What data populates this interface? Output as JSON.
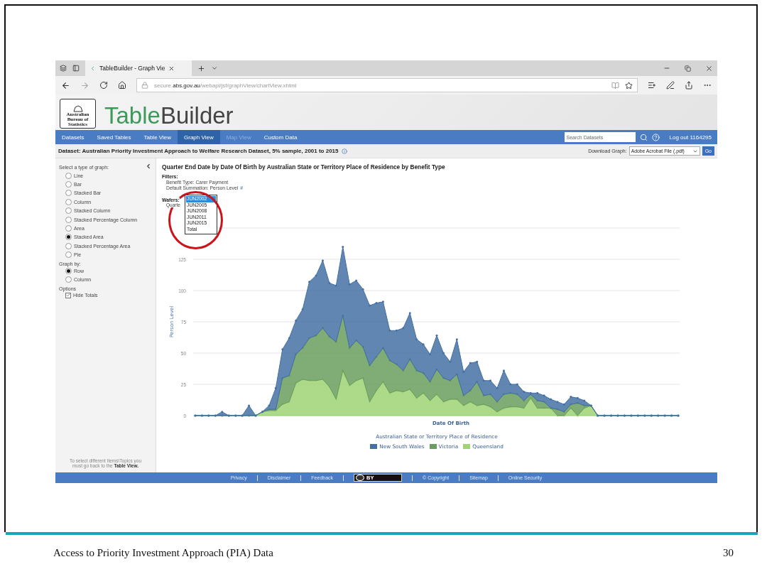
{
  "browser": {
    "tab_title": "TableBuilder - Graph Vie",
    "url": "secure.**abs.gov.au**/webapi/jsf/graphView/chartView.xhtml"
  },
  "header": {
    "logo_text": "Australian Bureau of Statistics",
    "app_title": "**Table**Builder"
  },
  "nav": {
    "items": [
      {
        "label": "Datasets",
        "selected": false,
        "disabled": false
      },
      {
        "label": "Saved Tables",
        "selected": false,
        "disabled": false
      },
      {
        "label": "Table View",
        "selected": false,
        "disabled": false
      },
      {
        "label": "Graph View",
        "selected": true,
        "disabled": false
      },
      {
        "label": "Map View",
        "selected": false,
        "disabled": true
      },
      {
        "label": "Custom Data",
        "selected": false,
        "disabled": false
      }
    ],
    "search": {
      "placeholder": "Search Datasets"
    },
    "logout": "Log out 1164295"
  },
  "dataset_bar": {
    "title": "Dataset: Australian Priority Investment Approach to Welfare Research Dataset, 5% sample, 2001 to 2015",
    "download_label": "Download Graph:",
    "download_format": "Adobe Acrobat File (.pdf)",
    "go": "Go"
  },
  "sidebar": {
    "graph_type_heading": "Select a type of graph:",
    "graph_types": [
      {
        "label": "Line",
        "selected": false
      },
      {
        "label": "Bar",
        "selected": false
      },
      {
        "label": "Stacked Bar",
        "selected": false
      },
      {
        "label": "Column",
        "selected": false
      },
      {
        "label": "Stacked Column",
        "selected": false
      },
      {
        "label": "Stacked Percentage Column",
        "selected": false
      },
      {
        "label": "Area",
        "selected": false
      },
      {
        "label": "Stacked Area",
        "selected": true
      },
      {
        "label": "Stacked Percentage Area",
        "selected": false
      },
      {
        "label": "Pie",
        "selected": false
      }
    ],
    "graph_by_heading": "Graph by:",
    "graph_by": [
      {
        "label": "Row",
        "selected": true
      },
      {
        "label": "Column",
        "selected": false
      }
    ],
    "options_heading": "Options",
    "options": [
      {
        "label": "Hide Totals",
        "checked": true
      }
    ],
    "note": "To select different Items\\Topics you must go back to the **Table View.**"
  },
  "chart_panel": {
    "title": "Quarter End Date by Date Of Birth by Australian State or Territory Place of Residence by Benefit Type",
    "filters_heading": "Filters:",
    "filters": [
      "Benefit Type: Carer Payment",
      "Default Summation: Person Level"
    ],
    "filter_link": "#",
    "wafers_label": "Wafers:",
    "wafer_row_label": "Quarte",
    "wafer_options": [
      {
        "label": "JUN2002",
        "selected": true
      },
      {
        "label": "JUN2005",
        "selected": false
      },
      {
        "label": "JUN2008",
        "selected": false
      },
      {
        "label": "JUN2011",
        "selected": false
      },
      {
        "label": "JUN2015",
        "selected": false
      },
      {
        "label": "Total",
        "selected": false
      }
    ],
    "legend_title": "Australian State or Territory Place of Residence",
    "chart_data": {
      "type": "area",
      "stacked": true,
      "grid": true,
      "xlabel": "Date Of Birth",
      "ylabel": "Person Level",
      "ylim": [
        0,
        150
      ],
      "yticks": [
        0,
        25,
        50,
        75,
        100,
        125
      ],
      "series": [
        {
          "name": "New South Wales",
          "color": "#4471a3",
          "values": [
            0,
            0,
            0,
            0,
            3,
            0,
            0,
            0,
            8,
            0,
            0,
            3,
            17,
            23,
            30,
            27,
            31,
            45,
            48,
            54,
            43,
            45,
            55,
            51,
            48,
            46,
            48,
            43,
            37,
            24,
            27,
            34,
            37,
            25,
            23,
            22,
            27,
            20,
            15,
            28,
            19,
            22,
            16,
            12,
            11,
            11,
            19,
            7,
            8,
            7,
            1,
            6,
            5,
            7,
            6,
            6,
            6,
            4,
            4,
            0,
            0,
            0,
            0,
            0,
            0,
            0,
            0,
            0,
            0,
            0,
            0,
            0,
            0
          ]
        },
        {
          "name": "Victoria",
          "color": "#6a9e5e",
          "values": [
            0,
            0,
            0,
            0,
            0,
            0,
            0,
            0,
            0,
            0,
            0,
            1,
            1,
            21,
            21,
            23,
            25,
            34,
            36,
            41,
            40,
            46,
            44,
            30,
            32,
            25,
            29,
            27,
            27,
            26,
            21,
            17,
            24,
            22,
            16,
            15,
            20,
            19,
            15,
            20,
            8,
            9,
            19,
            7,
            10,
            8,
            11,
            11,
            10,
            6,
            3,
            6,
            5,
            0,
            5,
            3,
            3,
            10,
            2,
            0,
            0,
            0,
            0,
            0,
            0,
            0,
            0,
            0,
            0,
            0,
            0,
            0,
            0
          ]
        },
        {
          "name": "Queensland",
          "color": "#9fd373",
          "values": [
            0,
            0,
            0,
            0,
            0,
            0,
            0,
            0,
            0,
            0,
            3,
            4,
            4,
            9,
            11,
            26,
            29,
            28,
            28,
            29,
            23,
            13,
            36,
            24,
            28,
            30,
            11,
            20,
            27,
            18,
            20,
            19,
            21,
            14,
            18,
            12,
            17,
            11,
            13,
            13,
            8,
            11,
            8,
            9,
            7,
            3,
            6,
            7,
            7,
            6,
            14,
            6,
            6,
            6,
            0,
            0,
            6,
            0,
            6,
            8,
            0,
            0,
            0,
            0,
            0,
            0,
            0,
            0,
            0,
            0,
            0,
            0,
            0
          ]
        }
      ]
    }
  },
  "footer": {
    "links": [
      "Privacy",
      "Disclaimer",
      "Feedback"
    ],
    "license": "BY",
    "links_after": [
      "© Copyright",
      "Sitemap",
      "Online Security"
    ]
  },
  "slide": {
    "footer_title": "Access to Priority Investment Approach (PIA) Data",
    "page_number": "30"
  }
}
